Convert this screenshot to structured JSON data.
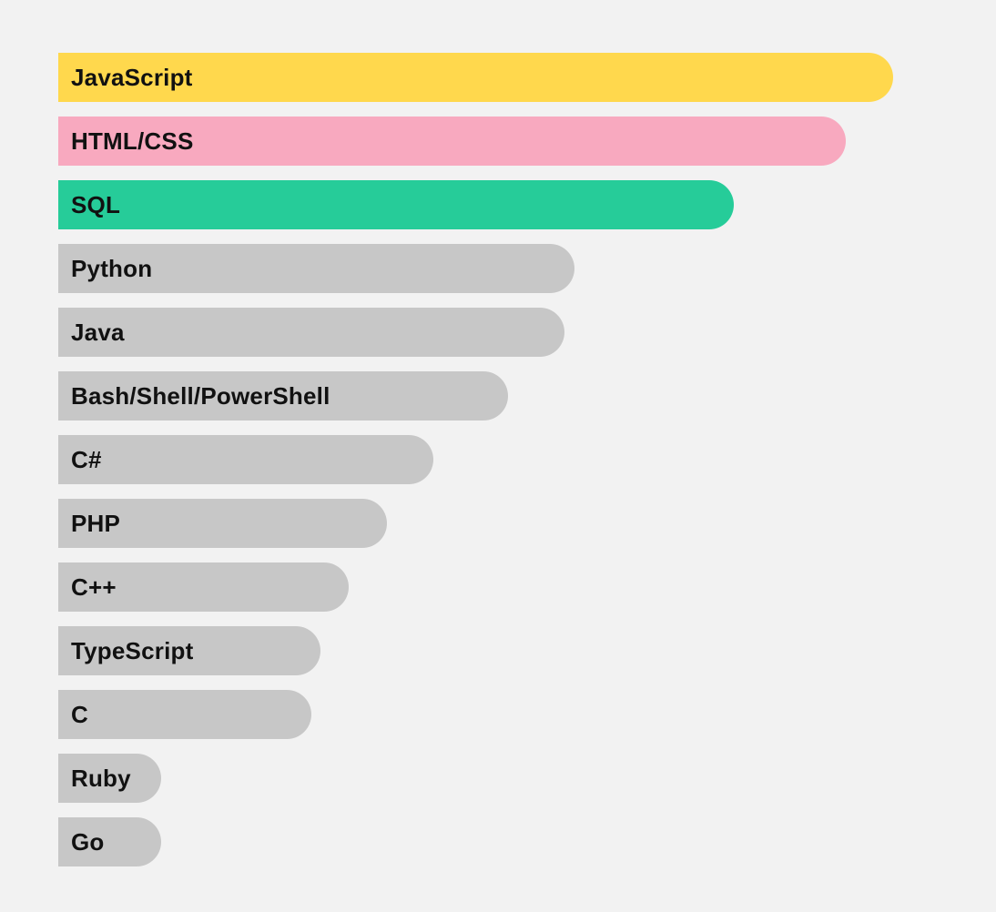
{
  "chart_data": {
    "type": "bar",
    "title": "",
    "xlabel": "",
    "ylabel": "",
    "xlim": [
      0,
      100
    ],
    "categories": [
      "JavaScript",
      "HTML/CSS",
      "SQL",
      "Python",
      "Java",
      "Bash/Shell/PowerShell",
      "C#",
      "PHP",
      "C++",
      "TypeScript",
      "C",
      "Ruby",
      "Go"
    ],
    "values": [
      89,
      84,
      72,
      55,
      54,
      48,
      40,
      35,
      31,
      28,
      27,
      11,
      11
    ],
    "colors": [
      "#ffd84d",
      "#f8a9bf",
      "#26cc99",
      "#c7c7c7",
      "#c7c7c7",
      "#c7c7c7",
      "#c7c7c7",
      "#c7c7c7",
      "#c7c7c7",
      "#c7c7c7",
      "#c7c7c7",
      "#c7c7c7",
      "#c7c7c7"
    ]
  }
}
